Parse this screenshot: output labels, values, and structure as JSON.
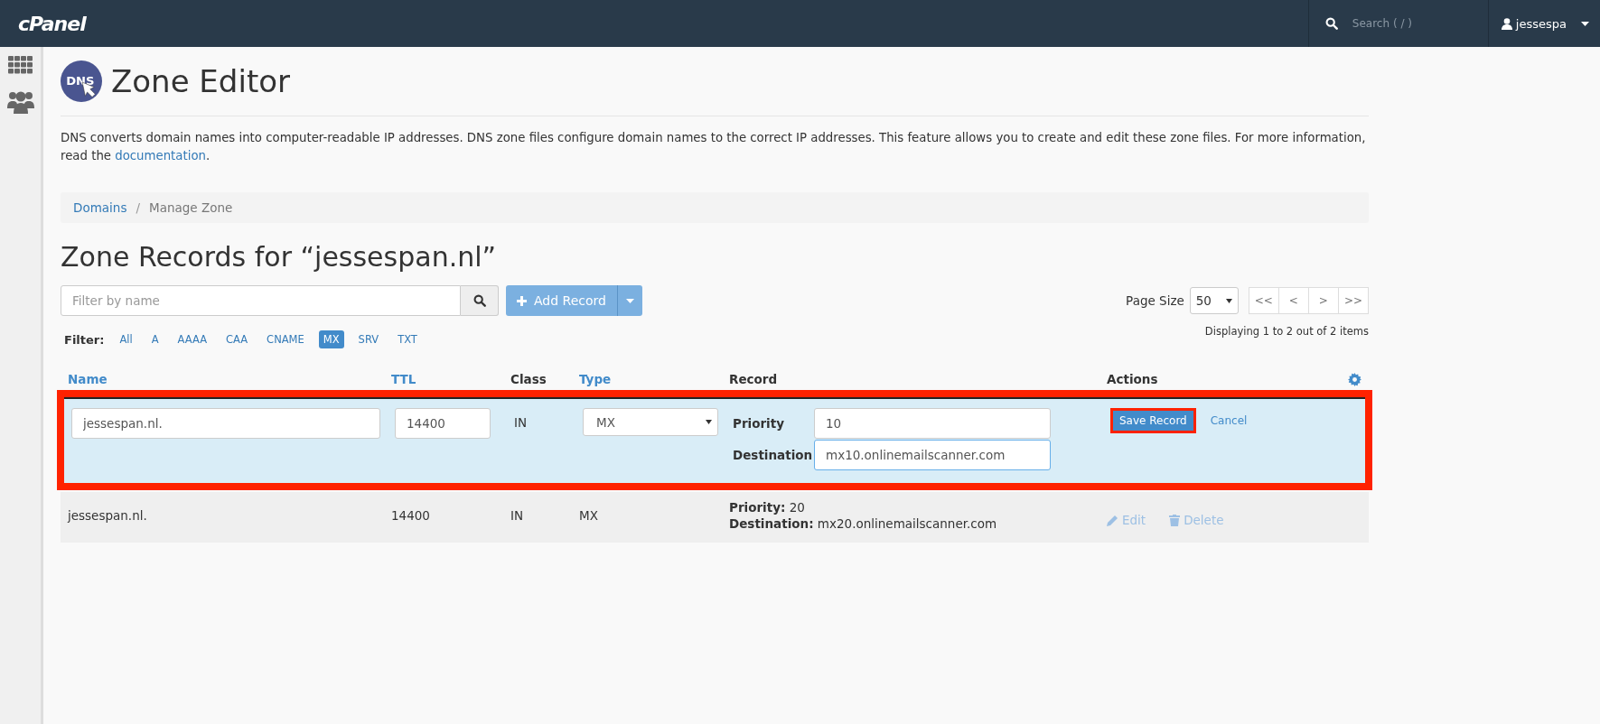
{
  "topbar": {
    "logo": "cPanel",
    "search": {
      "placeholder": "Search ( / )"
    },
    "user": "jessespa"
  },
  "page": {
    "icon_text": "DNS",
    "title": "Zone Editor",
    "description": "DNS converts domain names into computer-readable IP addresses. DNS zone files configure domain names to the correct IP addresses. This feature allows you to create and edit these zone files. For more information, read the ",
    "description_link": "documentation",
    "description_end": "."
  },
  "breadcrumb": {
    "separator": "/",
    "items": [
      {
        "label": "Domains",
        "kind": "link"
      },
      {
        "label": "Manage Zone",
        "kind": "current"
      }
    ]
  },
  "heading": "Zone Records for “jessespan.nl”",
  "filter_field": {
    "placeholder": "Filter by name"
  },
  "add_button": "Add Record",
  "page_size": {
    "label": "Page Size",
    "value": "50"
  },
  "pager": [
    "<<",
    "<",
    ">",
    ">>"
  ],
  "displaying": "Displaying 1 to 2 out of 2 items",
  "filter": {
    "label": "Filter:",
    "types": [
      {
        "label": "All",
        "selected": false
      },
      {
        "label": "A",
        "selected": false
      },
      {
        "label": "AAAA",
        "selected": false
      },
      {
        "label": "CAA",
        "selected": false
      },
      {
        "label": "CNAME",
        "selected": false
      },
      {
        "label": "MX",
        "selected": true
      },
      {
        "label": "SRV",
        "selected": false
      },
      {
        "label": "TXT",
        "selected": false
      }
    ]
  },
  "table": {
    "columns": [
      {
        "label": "Name",
        "sortable": true
      },
      {
        "label": "TTL",
        "sortable": true
      },
      {
        "label": "Class",
        "sortable": false
      },
      {
        "label": "Type",
        "sortable": true
      },
      {
        "label": "Record",
        "sortable": false
      },
      {
        "label": "Actions",
        "sortable": false
      }
    ],
    "rows": [
      {
        "kind": "edit",
        "highlighted": true,
        "name": "jessespan.nl.",
        "ttl": "14400",
        "class": "IN",
        "type": "MX",
        "priority_label": "Priority",
        "priority": "10",
        "destination_label": "Destination",
        "destination": "mx10.onlinemailscanner.com",
        "save": "Save Record",
        "cancel": "Cancel"
      },
      {
        "kind": "view",
        "highlighted": false,
        "name": "jessespan.nl.",
        "ttl": "14400",
        "class": "IN",
        "type": "MX",
        "record": [
          "**Priority:** 20",
          "**Destination:** mx20.onlinemailscanner.com"
        ],
        "edit": "Edit",
        "delete": "Delete"
      }
    ]
  }
}
